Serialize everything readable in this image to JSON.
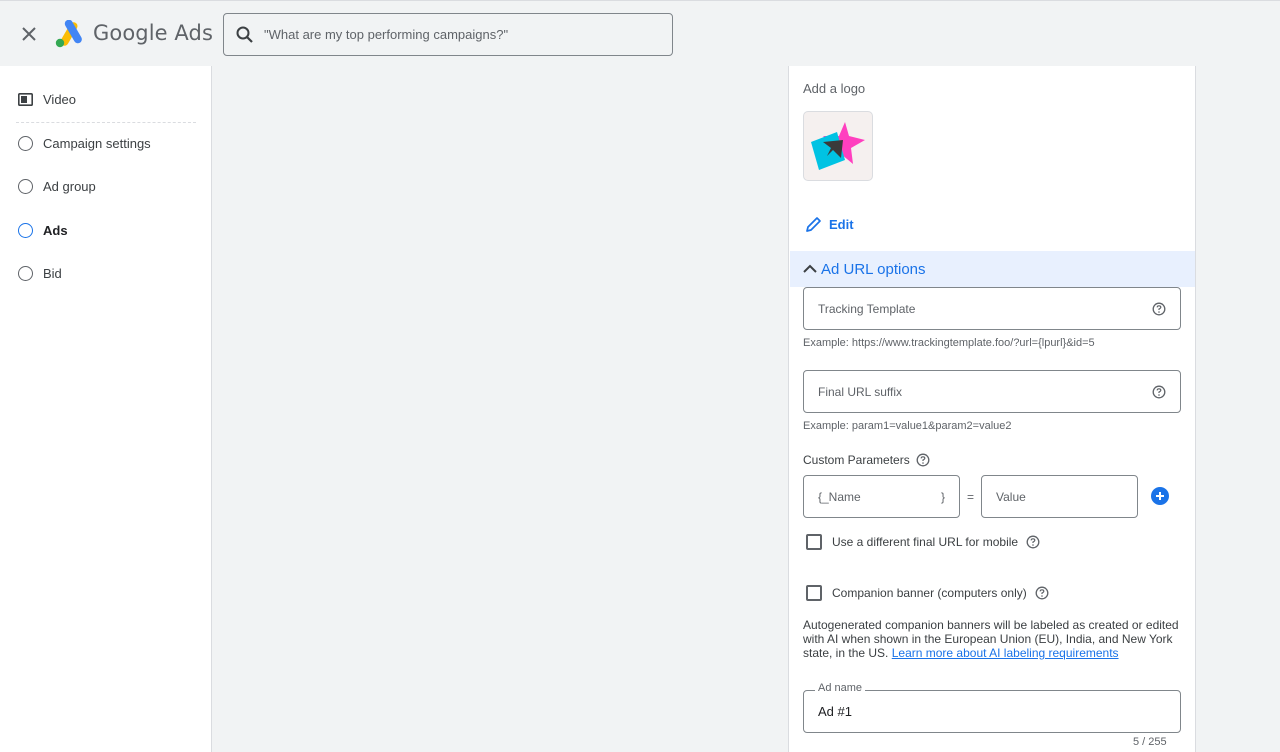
{
  "header": {
    "brand": "Google Ads",
    "search": {
      "placeholder": "\"What are my top performing campaigns?\""
    }
  },
  "sidebar": {
    "items": [
      {
        "label": "Video",
        "icon": "video-icon"
      },
      {
        "label": "Campaign settings"
      },
      {
        "label": "Ad group"
      },
      {
        "label": "Ads",
        "active": true
      },
      {
        "label": "Bid"
      }
    ]
  },
  "panel": {
    "logo_label": "Add a logo",
    "edit_label": "Edit",
    "url_options": {
      "title": "Ad URL options",
      "tracking_placeholder": "Tracking Template",
      "tracking_example": "Example: https://www.trackingtemplate.foo/?url={lpurl}&id=5",
      "suffix_placeholder": "Final URL suffix",
      "suffix_example": "Example: param1=value1&param2=value2",
      "custom_params_label": "Custom Parameters",
      "param_name_prefix": "{_Name",
      "param_name_suffix": "}",
      "equals": "=",
      "param_value_placeholder": "Value",
      "mobile_url_label": "Use a different final URL for mobile"
    },
    "companion": {
      "label": "Companion banner (computers only)",
      "note": "Autogenerated companion banners will be labeled as created or edited with AI when shown in the European Union (EU), India, and New York state, in the US.",
      "link": "Learn more about AI labeling requirements"
    },
    "ad_name": {
      "label": "Ad name",
      "value": "Ad #1",
      "counter": "5 / 255"
    }
  },
  "colors": {
    "accent": "#1a73e8",
    "section_bg": "#e8f0fe",
    "logo_blue": "#00c3e3",
    "logo_pink": "#ff3fbf"
  }
}
